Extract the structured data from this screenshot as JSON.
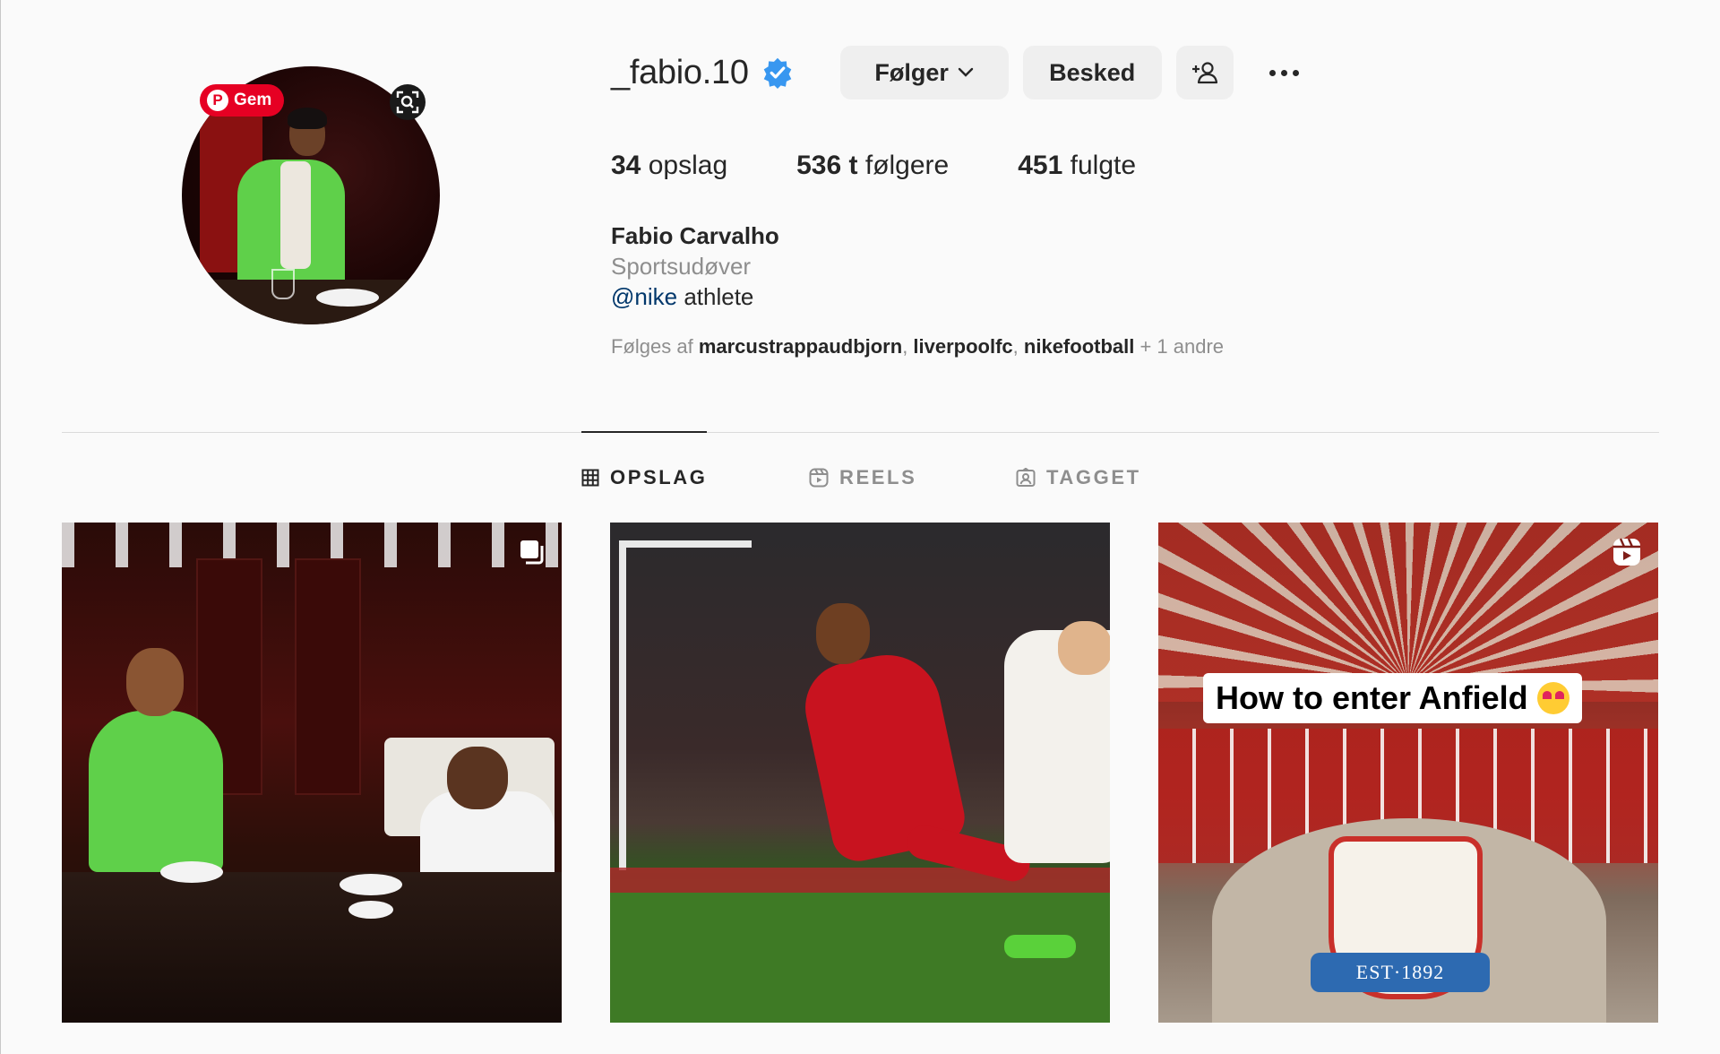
{
  "profile": {
    "username": "_fabio.10",
    "verified": true,
    "avatar_overlay": {
      "gem_label": "Gem"
    },
    "buttons": {
      "follow_label": "Følger",
      "message_label": "Besked"
    },
    "stats": {
      "posts_count": "34",
      "posts_label": "opslag",
      "followers_count": "536 t",
      "followers_label": "følgere",
      "following_count": "451",
      "following_label": "fulgte"
    },
    "bio": {
      "full_name": "Fabio Carvalho",
      "category": "Sportsudøver",
      "mention": "@nike",
      "text_after_mention": " athlete"
    },
    "followed_by": {
      "prefix": "Følges af ",
      "users": [
        "marcustrappaudbjorn",
        "liverpoolfc",
        "nikefootball"
      ],
      "suffix": " + 1 andre"
    }
  },
  "tabs": [
    {
      "label": "OPSLAG",
      "icon": "grid-icon",
      "active": true
    },
    {
      "label": "REELS",
      "icon": "reels-icon",
      "active": false
    },
    {
      "label": "TAGGET",
      "icon": "tagged-icon",
      "active": false
    }
  ],
  "posts": [
    {
      "type": "carousel",
      "icon": "multiple-images-icon"
    },
    {
      "type": "photo"
    },
    {
      "type": "reel",
      "icon": "reel-icon",
      "caption": "How to enter Anfield",
      "crest_text": "EST·1892"
    }
  ],
  "colors": {
    "verified_blue": "#3897f0",
    "pinterest_red": "#e60023",
    "mention_blue": "#00376b",
    "secondary_text": "#8e8e8e",
    "button_bg": "#efefef"
  }
}
